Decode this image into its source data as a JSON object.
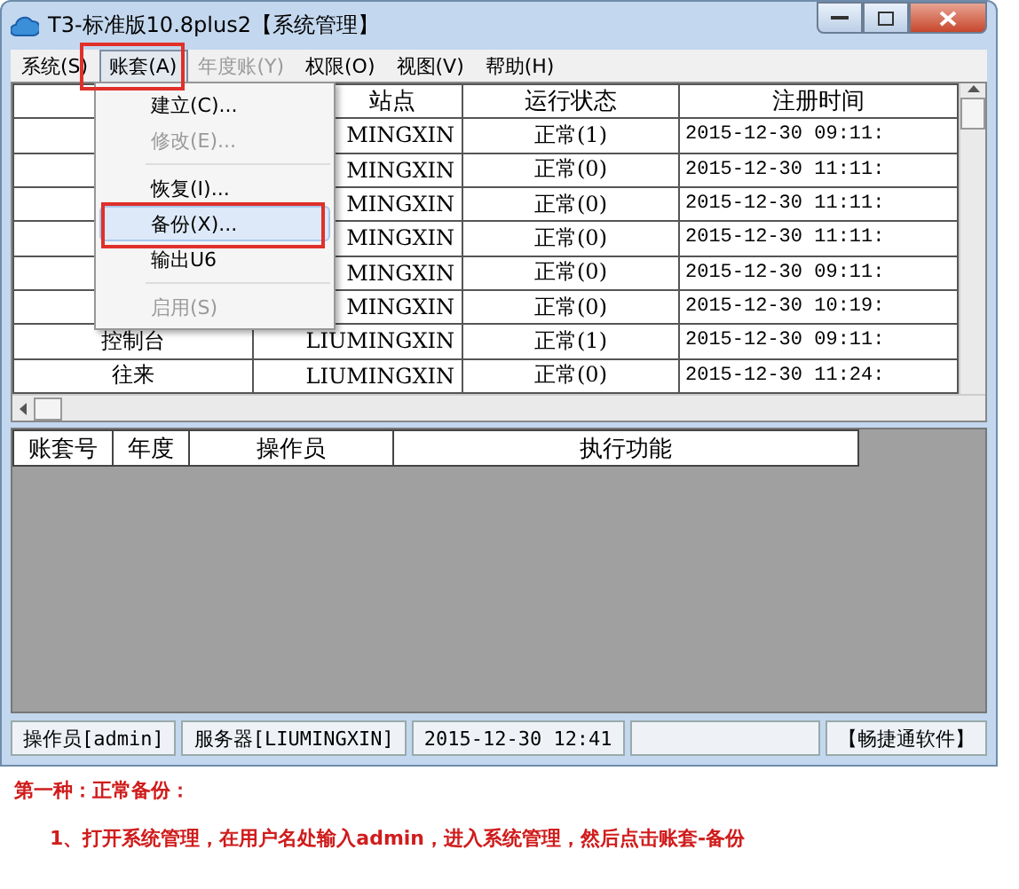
{
  "window": {
    "title": "T3-标准版10.8plus2【系统管理】"
  },
  "menu_bar": [
    {
      "label": "系统(S)",
      "disabled": false,
      "selected": false
    },
    {
      "label": "账套(A)",
      "disabled": false,
      "selected": true
    },
    {
      "label": "年度账(Y)",
      "disabled": true,
      "selected": false
    },
    {
      "label": "权限(O)",
      "disabled": false,
      "selected": false
    },
    {
      "label": "视图(V)",
      "disabled": false,
      "selected": false
    },
    {
      "label": "帮助(H)",
      "disabled": false,
      "selected": false
    }
  ],
  "dropdown": [
    {
      "kind": "item",
      "label": "建立(C)...",
      "disabled": false,
      "selected": false
    },
    {
      "kind": "item",
      "label": "修改(E)...",
      "disabled": true,
      "selected": false
    },
    {
      "kind": "separator"
    },
    {
      "kind": "item",
      "label": "恢复(I)...",
      "disabled": false,
      "selected": false
    },
    {
      "kind": "item",
      "label": "备份(X)...",
      "disabled": false,
      "selected": true
    },
    {
      "kind": "item",
      "label": "输出U6",
      "disabled": false,
      "selected": false
    },
    {
      "kind": "separator"
    },
    {
      "kind": "item",
      "label": "启用(S)",
      "disabled": true,
      "selected": false
    }
  ],
  "table": {
    "columns": [
      "站点",
      "运行状态",
      "注册时间"
    ],
    "rows": [
      {
        "site": "MINGXIN",
        "status": "正常(1)",
        "time": "2015-12-30 09:11:"
      },
      {
        "site": "MINGXIN",
        "status": "正常(0)",
        "time": "2015-12-30 11:11:"
      },
      {
        "site": "MINGXIN",
        "status": "正常(0)",
        "time": "2015-12-30 11:11:"
      },
      {
        "site": "MINGXIN",
        "status": "正常(0)",
        "time": "2015-12-30 11:11:"
      },
      {
        "site": "MINGXIN",
        "status": "正常(0)",
        "time": "2015-12-30 09:11:"
      },
      {
        "site": "MINGXIN",
        "status": "正常(0)",
        "time": "2015-12-30 10:19:"
      },
      {
        "column_1": "控制台",
        "site": "LIUMINGXIN",
        "status": "正常(1)",
        "time": "2015-12-30 09:11:"
      },
      {
        "column_1": "往来",
        "site": "LIUMINGXIN",
        "status": "正常(0)",
        "time": "2015-12-30 11:24:"
      }
    ]
  },
  "log_table": {
    "columns": [
      "账套号",
      "年度",
      "操作员",
      "执行功能"
    ]
  },
  "status_bar": [
    "操作员[admin]",
    "服务器[LIUMINGXIN]",
    "2015-12-30 12:41",
    "【畅捷通软件】"
  ],
  "caption": {
    "heading": "第一种：正常备份：",
    "step": "1、打开系统管理，在用户名处输入admin，进入系统管理，然后点击账套-备份"
  }
}
